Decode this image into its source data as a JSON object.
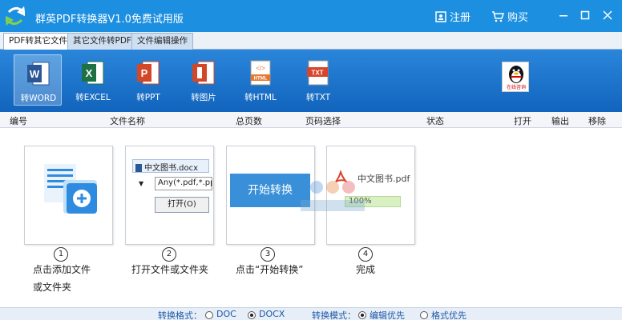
{
  "window": {
    "title": "群英PDF转换器V1.0免费试用版",
    "register_label": "注册",
    "buy_label": "购买",
    "minimize_icon": "minimize-icon",
    "maximize_icon": "maximize-icon",
    "close_icon": "close-icon",
    "accent_color": "#1d8fe0"
  },
  "tabs": [
    {
      "label": "PDF转其它文件",
      "active": true
    },
    {
      "label": "其它文件转PDF",
      "active": false
    },
    {
      "label": "文件编辑操作",
      "active": false
    }
  ],
  "ribbon": {
    "items": [
      {
        "label": "转WORD",
        "icon": "word-icon",
        "color": "#2b5797",
        "active": true
      },
      {
        "label": "转EXCEL",
        "icon": "excel-icon",
        "color": "#1e7145",
        "active": false
      },
      {
        "label": "转PPT",
        "icon": "ppt-icon",
        "color": "#d24726",
        "active": false
      },
      {
        "label": "转图片",
        "icon": "image-icon",
        "color": "#d24726",
        "active": false
      },
      {
        "label": "转HTML",
        "icon": "html-icon",
        "color": "#e8772e",
        "active": false
      },
      {
        "label": "转TXT",
        "icon": "txt-icon",
        "color": "#d9442c",
        "active": false
      }
    ],
    "qq_label": "在线咨询"
  },
  "columns": [
    "编号",
    "文件名称",
    "总页数",
    "页码选择",
    "状态",
    "打开",
    "输出",
    "移除"
  ],
  "steps": [
    {
      "num": "1",
      "desc_line1": "点击添加文件",
      "desc_line2": "或文件夹"
    },
    {
      "num": "2",
      "desc_line1": "打开文件或文件夹",
      "filename": "中文图书.docx",
      "filter": "Any(*.pdf,*.ppt,*",
      "open_btn": "打开(O)"
    },
    {
      "num": "3",
      "desc_line1": "点击“开始转换”",
      "start_btn": "开始转换"
    },
    {
      "num": "4",
      "desc_line1": "完成",
      "filename": "中文图书.pdf",
      "progress": "100%"
    }
  ],
  "footer": {
    "format_label": "转换格式：",
    "options": [
      "DOC",
      "DOCX"
    ],
    "selected_format": "DOCX",
    "mode_label": "转换模式：",
    "modes": [
      "编辑优先",
      "格式优先"
    ],
    "selected_mode": "编辑优先"
  }
}
